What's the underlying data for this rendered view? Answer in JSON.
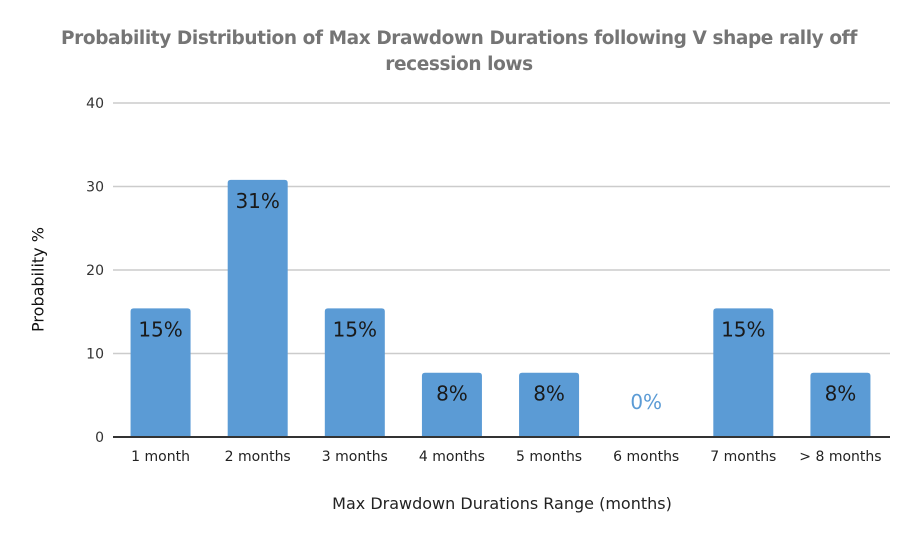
{
  "chart_data": {
    "type": "bar",
    "title": "Probability Distribution of Max Drawdown Durations following V shape rally off recession lows",
    "title_lines": [
      "Probability Distribution of Max Drawdown Durations following V shape rally off",
      "recession lows"
    ],
    "xlabel": "Max Drawdown Durations Range (months)",
    "ylabel": "Probability %",
    "categories": [
      "1 month",
      "2 months",
      "3 months",
      "4 months",
      "5 months",
      "6 months",
      "7 months",
      "> 8 months"
    ],
    "values": [
      15.4,
      30.8,
      15.4,
      7.7,
      7.7,
      0,
      15.4,
      7.7
    ],
    "data_labels": [
      "15%",
      "31%",
      "15%",
      "8%",
      "8%",
      "0%",
      "15%",
      "8%"
    ],
    "ylim": [
      0,
      40
    ],
    "yticks": [
      0,
      10,
      20,
      30,
      40
    ],
    "grid": true,
    "legend": "none",
    "colors": {
      "bar": "#5b9bd5",
      "label": "#1a1a1a",
      "zero_label": "#5b9bd5",
      "grid": "#cccccc",
      "axis": "#333333"
    }
  }
}
